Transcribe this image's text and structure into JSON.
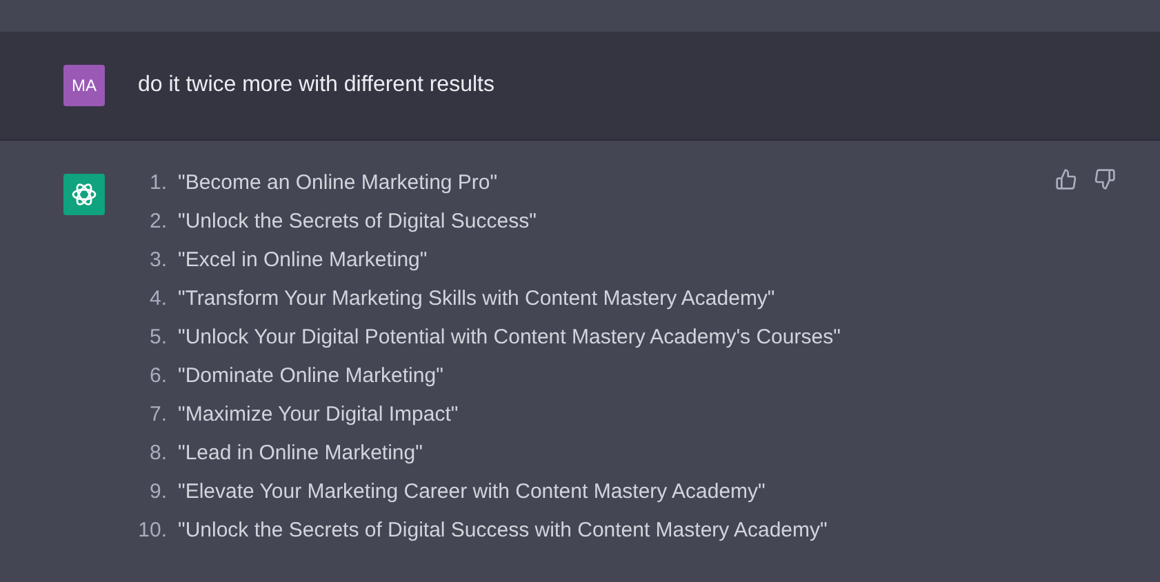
{
  "messages": [
    {
      "kind": "user",
      "avatar": "MA",
      "text": "do it twice more with different results"
    },
    {
      "kind": "assistant",
      "items": [
        {
          "number": "1.",
          "text": "\"Become an Online Marketing Pro\""
        },
        {
          "number": "2.",
          "text": "\"Unlock the Secrets of Digital Success\""
        },
        {
          "number": "3.",
          "text": "\"Excel in Online Marketing\""
        },
        {
          "number": "4.",
          "text": "\"Transform Your Marketing Skills with Content Mastery Academy\""
        },
        {
          "number": "5.",
          "text": "\"Unlock Your Digital Potential with Content Mastery Academy's Courses\""
        },
        {
          "number": "6.",
          "text": "\"Dominate Online Marketing\""
        },
        {
          "number": "7.",
          "text": "\"Maximize Your Digital Impact\""
        },
        {
          "number": "8.",
          "text": "\"Lead in Online Marketing\""
        },
        {
          "number": "9.",
          "text": "\"Elevate Your Marketing Career with Content Mastery Academy\""
        },
        {
          "number": "10.",
          "text": "\"Unlock the Secrets of Digital Success with Content Mastery Academy\""
        }
      ]
    }
  ]
}
